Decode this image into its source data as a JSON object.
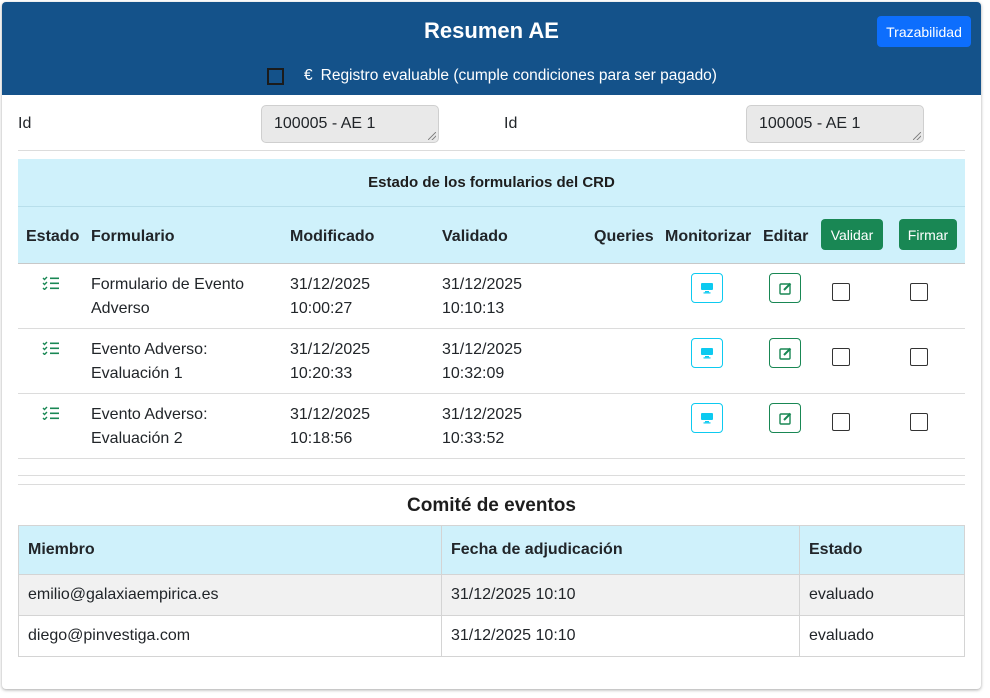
{
  "header": {
    "title": "Resumen AE",
    "trazabilidad_label": "Trazabilidad",
    "euro_symbol": "€",
    "registro_label": "Registro evaluable (cumple condiciones para ser pagado)",
    "registro_checked": false
  },
  "id_fields": [
    {
      "label": "Id",
      "value": "100005 - AE 1"
    },
    {
      "label": "Id",
      "value": "100005 - AE 1"
    }
  ],
  "crd": {
    "title": "Estado de los formularios del CRD",
    "headers": {
      "estado": "Estado",
      "formulario": "Formulario",
      "modificado": "Modificado",
      "validado": "Validado",
      "queries": "Queries",
      "monitorizar": "Monitorizar",
      "editar": "Editar"
    },
    "validar_label": "Validar",
    "firmar_label": "Firmar",
    "rows": [
      {
        "form_line1": "Formulario de Evento",
        "form_line2": "Adverso",
        "mod_date": "31/12/2025",
        "mod_time": "10:00:27",
        "val_date": "31/12/2025",
        "val_time": "10:10:13",
        "validar": false,
        "firmar": false
      },
      {
        "form_line1": "Evento Adverso:",
        "form_line2": "Evaluación 1",
        "mod_date": "31/12/2025",
        "mod_time": "10:20:33",
        "val_date": "31/12/2025",
        "val_time": "10:32:09",
        "validar": false,
        "firmar": false
      },
      {
        "form_line1": "Evento Adverso:",
        "form_line2": "Evaluación 2",
        "mod_date": "31/12/2025",
        "mod_time": "10:18:56",
        "val_date": "31/12/2025",
        "val_time": "10:33:52",
        "validar": false,
        "firmar": false
      }
    ],
    "icons": {
      "estado": "list-check-icon",
      "monitorizar": "monitor-icon",
      "editar": "edit-icon"
    }
  },
  "comite": {
    "title": "Comité de eventos",
    "headers": {
      "miembro": "Miembro",
      "fecha": "Fecha de adjudicación",
      "estado": "Estado"
    },
    "rows": [
      {
        "miembro": "emilio@galaxiaempirica.es",
        "fecha": "31/12/2025 10:10",
        "estado": "evaluado"
      },
      {
        "miembro": "diego@pinvestiga.com",
        "fecha": "31/12/2025 10:10",
        "estado": "evaluado"
      }
    ]
  },
  "colors": {
    "header_bg": "#14528a",
    "primary_button": "#0d6efd",
    "success_button": "#198754",
    "info_outline": "#0dcaf0",
    "table_header_bg": "#cff1fb"
  }
}
